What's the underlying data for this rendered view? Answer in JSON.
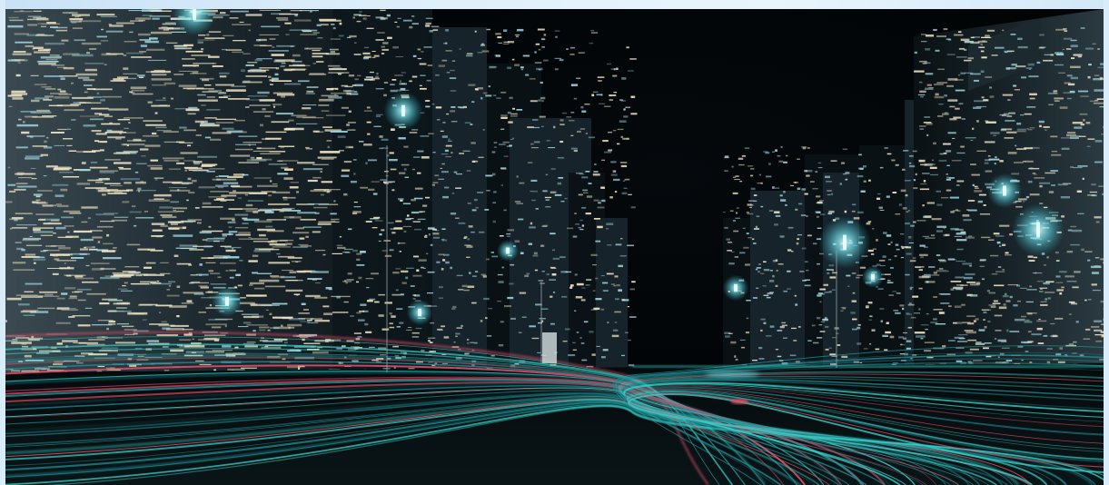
{
  "scene": {
    "subject": "night-city-light-trails",
    "colors": {
      "sky": "#020406",
      "building_dark": "#0b1216",
      "building_mid": "#17252c",
      "window_warm": "#f2e6c4",
      "window_cool": "#9fd4de",
      "trail_cyan": "#35d0c8",
      "trail_teal": "#1f8f95",
      "trail_red": "#e0506a",
      "glow": "#7ff3ff",
      "frame_bg": "#d9ecfa"
    },
    "icons": [
      "street-lamp-icon"
    ]
  }
}
